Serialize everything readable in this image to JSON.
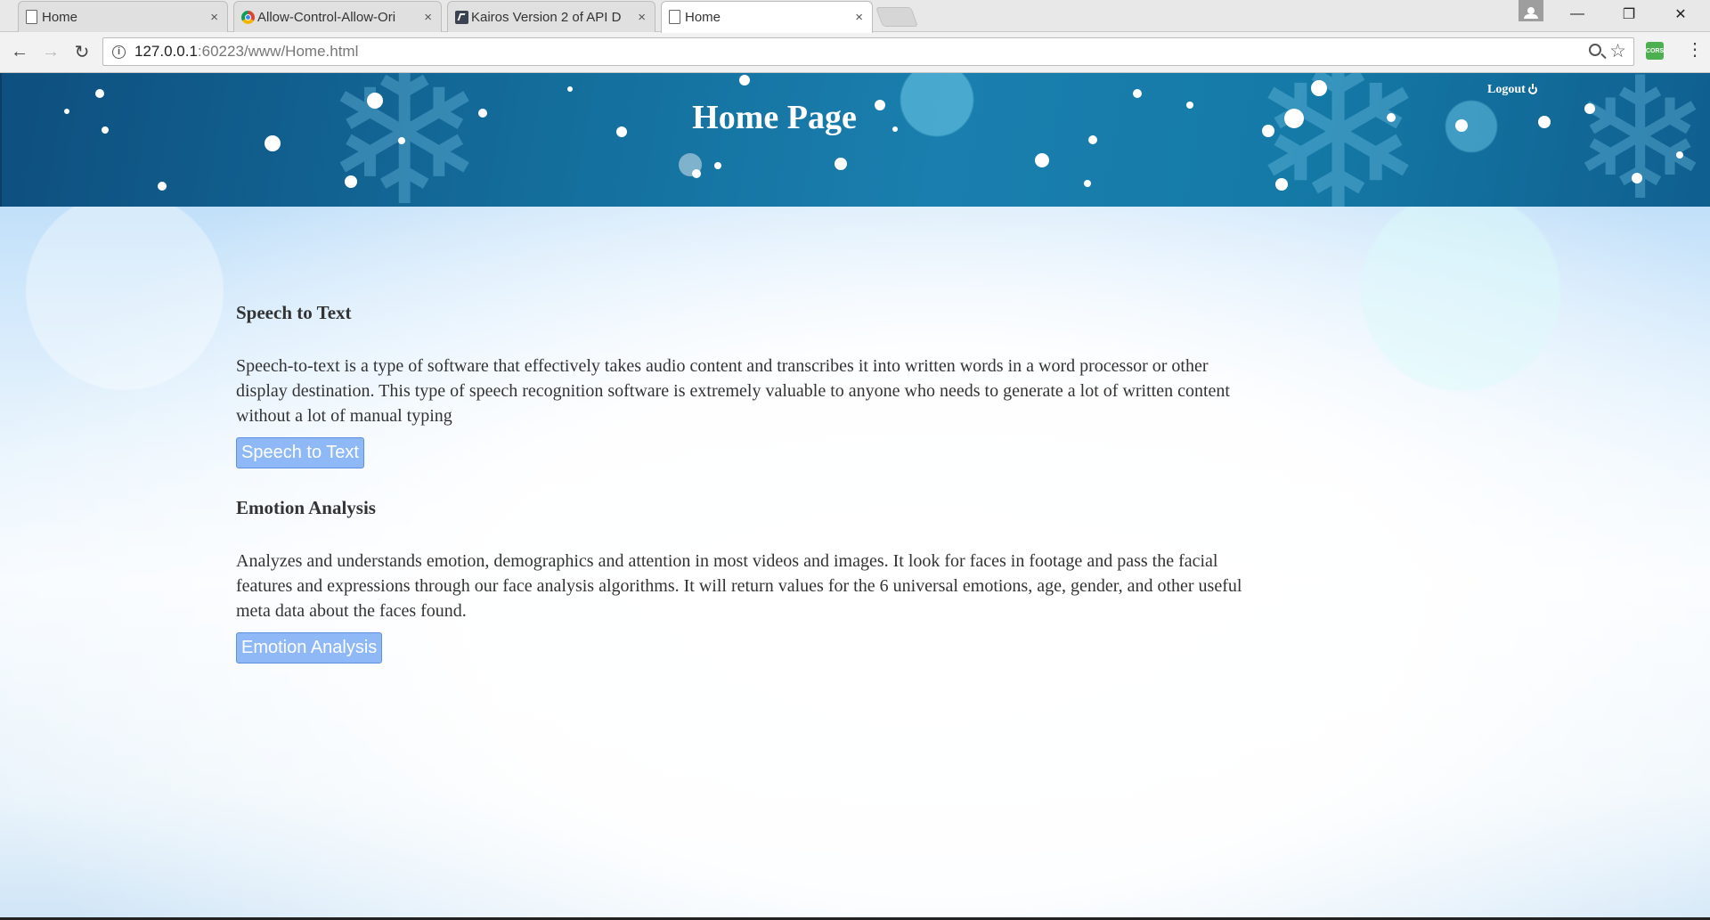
{
  "browser": {
    "tabs": [
      {
        "title": "Home",
        "favicon": "document-icon",
        "active": false
      },
      {
        "title": "Allow-Control-Allow-Ori",
        "favicon": "chrome-webstore-icon",
        "active": false
      },
      {
        "title": "Kairos Version 2 of API D",
        "favicon": "kairos-icon",
        "active": false
      },
      {
        "title": "Home",
        "favicon": "document-icon",
        "active": true
      }
    ],
    "close_glyph": "×",
    "url_host": "127.0.0.1",
    "url_rest": ":60223/www/Home.html",
    "extension_label": "CORS",
    "window_controls": [
      "—",
      "❐",
      "✕"
    ]
  },
  "header": {
    "title": "Home Page",
    "logout_label": "Logout"
  },
  "sections": [
    {
      "heading": "Speech to Text",
      "description": "Speech-to-text is a type of software that effectively takes audio content and transcribes it into written words in a word processor or other display destination. This type of speech recognition software is extremely valuable to anyone who needs to generate a lot of written content without a lot of manual typing",
      "button_label": "Speech to Text"
    },
    {
      "heading": "Emotion Analysis",
      "description": "Analyzes and understands emotion, demographics and attention in most videos and images. It look for faces in footage and pass the facial features and expressions through our face analysis algorithms. It will return values for the 6 universal emotions, age, gender, and other useful meta data about the faces found.",
      "button_label": "Emotion Analysis"
    }
  ],
  "colors": {
    "banner": "#14709e",
    "button_bg": "#8eb8f6",
    "button_border": "#5f90e3",
    "text": "#333333"
  }
}
